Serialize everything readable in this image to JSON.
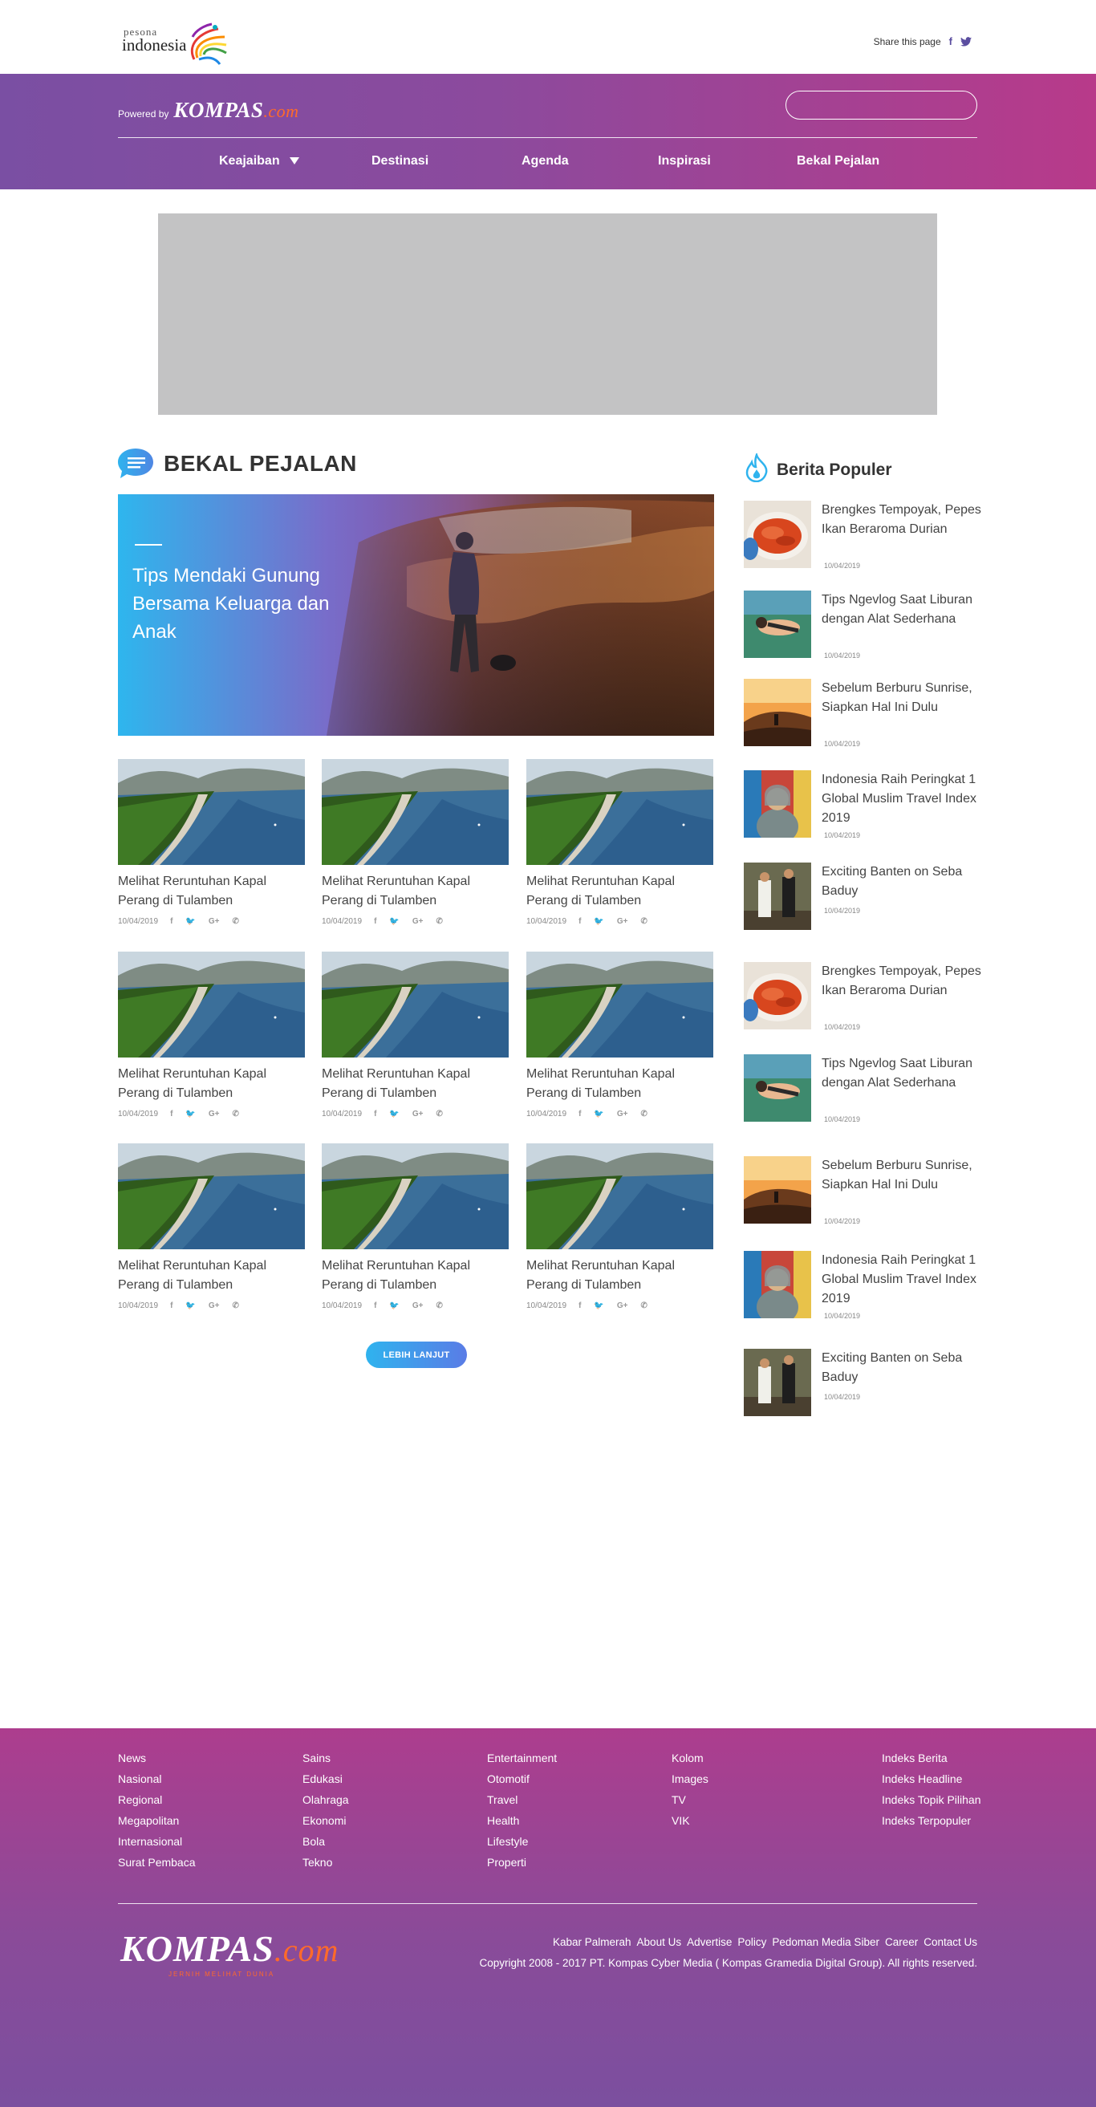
{
  "header": {
    "logo_small": "pesona",
    "logo_big": "indonesia",
    "share_label": "Share this page",
    "facebook_glyph": "f",
    "twitter_glyph": "🐦"
  },
  "nav": {
    "powered_label": "Powered by",
    "brand": "KOMPAS",
    "brand_suffix": ".com",
    "search_placeholder": "",
    "items": [
      {
        "label": "Keajaiban"
      },
      {
        "label": "Destinasi"
      },
      {
        "label": "Agenda"
      },
      {
        "label": "Inspirasi"
      },
      {
        "label": "Bekal Pejalan"
      }
    ]
  },
  "section": {
    "title": "BEKAL PEJALAN",
    "hero_title": "Tips Mendaki Gunung Bersama Keluarga dan Anak"
  },
  "cards": [
    {
      "title": "Melihat Reruntuhan Kapal Perang di Tulamben",
      "date": "10/04/2019"
    },
    {
      "title": "Melihat Reruntuhan Kapal Perang di Tulamben",
      "date": "10/04/2019"
    },
    {
      "title": "Melihat Reruntuhan Kapal Perang di Tulamben",
      "date": "10/04/2019"
    },
    {
      "title": "Melihat Reruntuhan Kapal Perang di Tulamben",
      "date": "10/04/2019"
    },
    {
      "title": "Melihat Reruntuhan Kapal Perang di Tulamben",
      "date": "10/04/2019"
    },
    {
      "title": "Melihat Reruntuhan Kapal Perang di Tulamben",
      "date": "10/04/2019"
    },
    {
      "title": "Melihat Reruntuhan Kapal Perang di Tulamben",
      "date": "10/04/2019"
    },
    {
      "title": "Melihat Reruntuhan Kapal Perang di Tulamben",
      "date": "10/04/2019"
    },
    {
      "title": "Melihat Reruntuhan Kapal Perang di Tulamben",
      "date": "10/04/2019"
    }
  ],
  "share_icons": {
    "facebook": "f",
    "twitter": "🐦",
    "gplus": "G+",
    "whatsapp": "✆"
  },
  "more_label": "LEBIH LANJUT",
  "sidebar": {
    "title": "Berita Populer",
    "items": [
      {
        "title": "Brengkes Tempoyak, Pepes Ikan Beraroma Durian",
        "date": "10/04/2019",
        "thumb": "food"
      },
      {
        "title": "Tips Ngevlog Saat Liburan dengan Alat Sederhana",
        "date": "10/04/2019",
        "thumb": "swim"
      },
      {
        "title": "Sebelum Berburu Sunrise, Siapkan Hal Ini Dulu",
        "date": "10/04/2019",
        "thumb": "sunrise"
      },
      {
        "title": "Indonesia Raih Peringkat 1 Global Muslim Travel Index 2019",
        "date": "10/04/2019",
        "thumb": "woman"
      },
      {
        "title": "Exciting Banten on Seba Baduy",
        "date": "10/04/2019",
        "thumb": "baduy"
      },
      {
        "title": "Brengkes Tempoyak, Pepes Ikan Beraroma Durian",
        "date": "10/04/2019",
        "thumb": "food"
      },
      {
        "title": "Tips Ngevlog Saat Liburan dengan Alat Sederhana",
        "date": "10/04/2019",
        "thumb": "swim"
      },
      {
        "title": "Sebelum Berburu Sunrise, Siapkan Hal Ini Dulu",
        "date": "10/04/2019",
        "thumb": "sunrise"
      },
      {
        "title": "Indonesia Raih Peringkat 1 Global Muslim Travel Index 2019",
        "date": "10/04/2019",
        "thumb": "woman"
      },
      {
        "title": "Exciting Banten on Seba Baduy",
        "date": "10/04/2019",
        "thumb": "baduy"
      }
    ]
  },
  "footer": {
    "columns": [
      [
        "News",
        "Nasional",
        "Regional",
        "Megapolitan",
        "Internasional",
        "Surat Pembaca"
      ],
      [
        "Sains",
        "Edukasi",
        "Olahraga",
        "Ekonomi",
        "Bola",
        "Tekno"
      ],
      [
        "Entertainment",
        "Otomotif",
        "Travel",
        "Health",
        "Lifestyle",
        "Properti"
      ],
      [
        "Kolom",
        "Images",
        "TV",
        "VIK"
      ],
      [
        "Indeks Berita",
        "Indeks Headline",
        "Indeks Topik Pilihan",
        "Indeks Terpopuler"
      ]
    ],
    "brand": "KOMPAS",
    "brand_suffix": ".com",
    "tagline": "JERNIH MELIHAT DUNIA",
    "links": [
      "Kabar Palmerah",
      "About Us",
      "Advertise",
      "Policy",
      "Pedoman Media Siber",
      "Career",
      "Contact Us"
    ],
    "copyright": "Copyright 2008 - 2017 PT. Kompas Cyber Media ( Kompas Gramedia Digital Group). All rights reserved."
  },
  "colors": {
    "nav_start": "#7a4fa3",
    "nav_end": "#b83a8a",
    "accent_orange": "#ff6a2a",
    "button_blue": "#2fb3ee"
  }
}
